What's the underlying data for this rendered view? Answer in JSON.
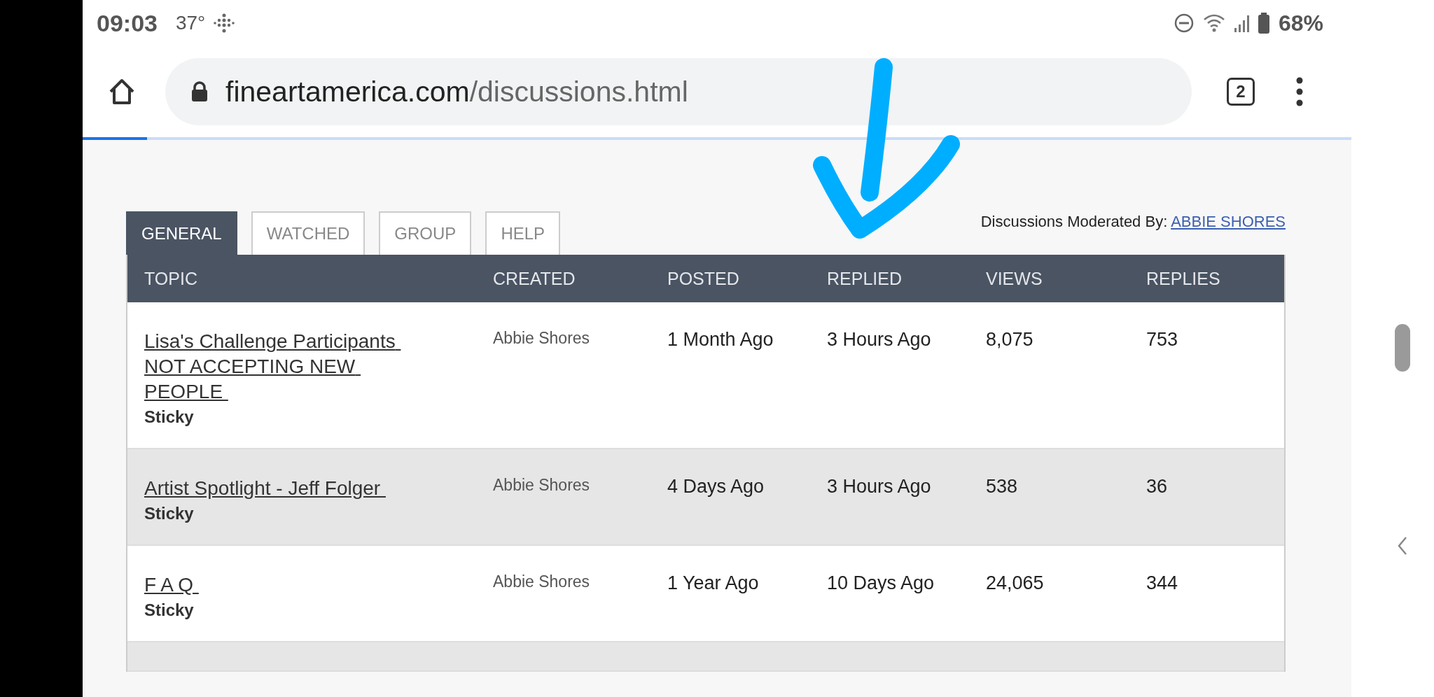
{
  "status_bar": {
    "time": "09:03",
    "temperature": "37°",
    "battery": "68%"
  },
  "browser": {
    "url_host": "fineartamerica.com",
    "url_path": "/discussions.html",
    "tab_count": "2"
  },
  "tabs": [
    {
      "label": "GENERAL",
      "selected": true
    },
    {
      "label": "WATCHED",
      "selected": false
    },
    {
      "label": "GROUP",
      "selected": false
    },
    {
      "label": "HELP",
      "selected": false
    }
  ],
  "moderator": {
    "label": "Discussions Moderated By:",
    "link": "ABBIE SHORES"
  },
  "table": {
    "columns": [
      "TOPIC",
      "CREATED",
      "POSTED",
      "REPLIED",
      "VIEWS",
      "REPLIES"
    ],
    "rows": [
      {
        "topic": "Lisa's Challenge Participants NOT ACCEPTING NEW PEOPLE ",
        "tag": "Sticky",
        "created": "Abbie Shores",
        "posted": "1 Month Ago",
        "replied": "3 Hours Ago",
        "views": "8,075",
        "replies": "753"
      },
      {
        "topic": "Artist Spotlight - Jeff Folger ",
        "tag": "Sticky",
        "created": "Abbie Shores",
        "posted": "4 Days Ago",
        "replied": "3 Hours Ago",
        "views": "538",
        "replies": "36"
      },
      {
        "topic": "F A Q ",
        "tag": "Sticky",
        "created": "Abbie Shores",
        "posted": "1 Year Ago",
        "replied": "10 Days Ago",
        "views": "24,065",
        "replies": "344"
      }
    ]
  }
}
